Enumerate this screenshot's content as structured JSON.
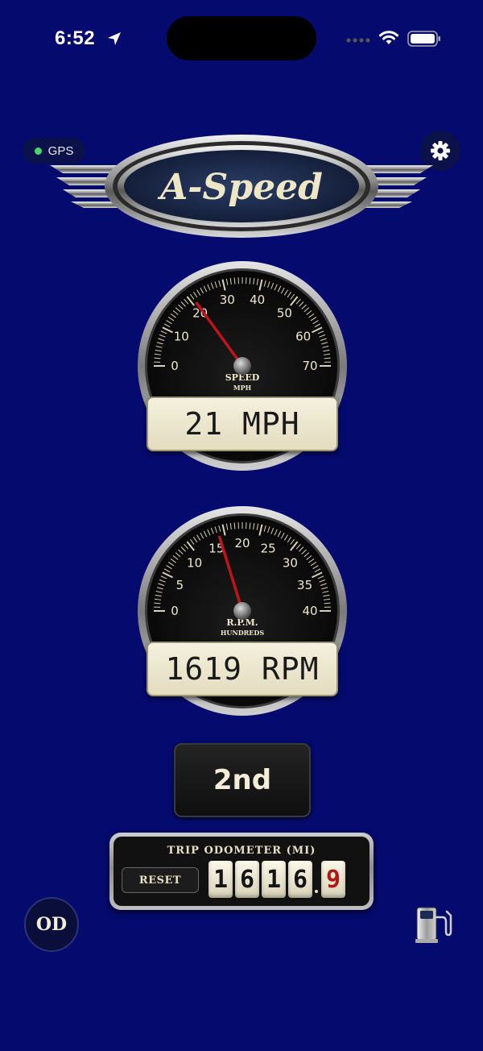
{
  "status_bar": {
    "time": "6:52"
  },
  "gps": {
    "label": "GPS"
  },
  "logo": {
    "text": "A-Speed"
  },
  "speedometer": {
    "ticks": [
      "0",
      "10",
      "20",
      "30",
      "40",
      "50",
      "60",
      "70"
    ],
    "label_top": "SPEED",
    "label_bottom": "MPH",
    "readout": "21 MPH",
    "value": 21,
    "max": 70
  },
  "tachometer": {
    "ticks": [
      "0",
      "5",
      "10",
      "15",
      "20",
      "25",
      "30",
      "35",
      "40"
    ],
    "label_top": "R.P.M.",
    "label_bottom": "HUNDREDS",
    "readout": "1619 RPM",
    "value": 16.19,
    "max": 40
  },
  "gear": {
    "label": "2nd"
  },
  "odometer": {
    "title": "TRIP ODOMETER (MI)",
    "reset_label": "RESET",
    "digits": [
      "1",
      "6",
      "1",
      "6"
    ],
    "tenth": "9"
  },
  "od_button": {
    "label": "OD"
  },
  "colors": {
    "background": "#050a6e",
    "needle": "#c0141a",
    "dial": "#0d0d0d",
    "bezel": "#b8b8b8"
  }
}
